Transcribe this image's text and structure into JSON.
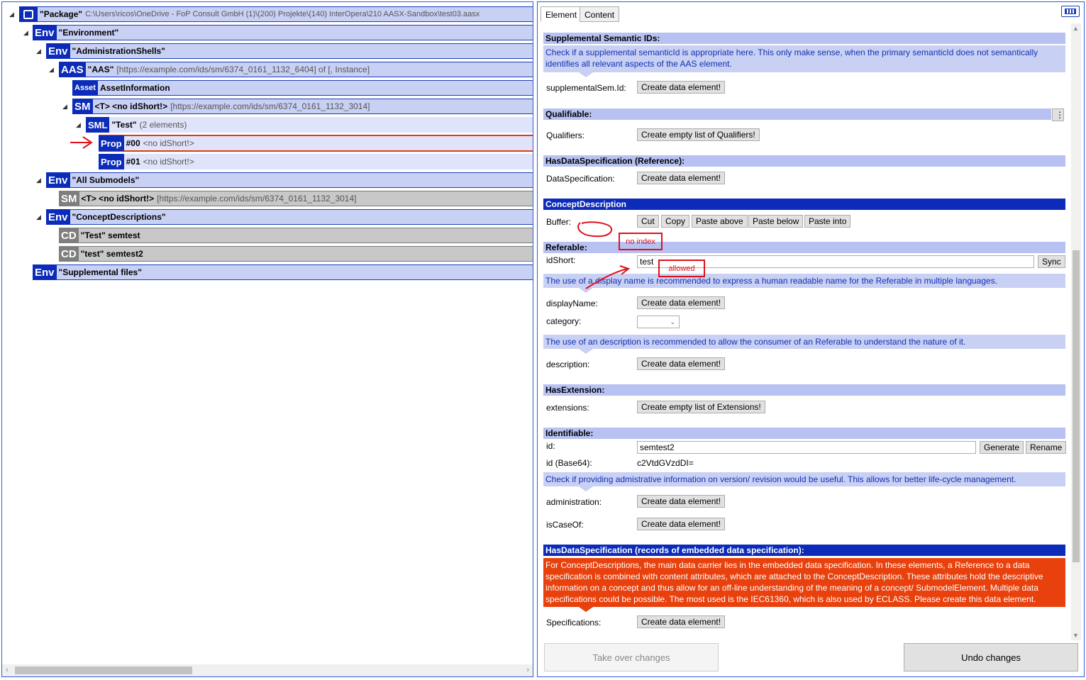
{
  "tree": {
    "package": {
      "name": "\"Package\"",
      "path": "C:\\Users\\ricos\\OneDrive - FoP Consult GmbH (1)\\(200) Projekte\\(140) InterOpera\\210 AASX-Sandbox\\test03.aasx"
    },
    "env_environment": {
      "badge": "Env",
      "name": "\"Environment\""
    },
    "env_aas": {
      "badge": "Env",
      "name": "\"AdministrationShells\""
    },
    "aas": {
      "badge": "AAS",
      "name": "\"AAS\"",
      "info": "[https://example.com/ids/sm/6374_0161_1132_6404] of [, Instance]"
    },
    "asset": {
      "badge": "Asset",
      "name": "AssetInformation"
    },
    "sm": {
      "badge": "SM",
      "name": "<T> <no idShort!>",
      "info": "[https://example.com/ids/sm/6374_0161_1132_3014]"
    },
    "sml": {
      "badge": "SML",
      "name": "\"Test\"",
      "info": "(2 elements)"
    },
    "prop0": {
      "badge": "Prop",
      "name": "#00",
      "info": "<no idShort!>"
    },
    "prop1": {
      "badge": "Prop",
      "name": "#01",
      "info": "<no idShort!>"
    },
    "env_subs": {
      "badge": "Env",
      "name": "\"All Submodels\""
    },
    "sm_all": {
      "badge": "SM",
      "name": "<T> <no idShort!>",
      "info": "[https://example.com/ids/sm/6374_0161_1132_3014]"
    },
    "env_cd": {
      "badge": "Env",
      "name": "\"ConceptDescriptions\""
    },
    "cd1": {
      "badge": "CD",
      "name": "\"Test\" semtest"
    },
    "cd2": {
      "badge": "CD",
      "name": "\"test\" semtest2"
    },
    "env_files": {
      "badge": "Env",
      "name": "\"Supplemental files\""
    }
  },
  "editor": {
    "tabs": [
      "Element",
      "Content"
    ],
    "supp": {
      "header": "Supplemental Semantic IDs:",
      "hint": "Check if a supplemental semanticId is appropriate here. This only make sense, when the primary semanticId does not semantically identifies all relevant aspects of the AAS element.",
      "label": "supplementalSem.Id:",
      "button": "Create data element!"
    },
    "qual": {
      "header": "Qualifiable:",
      "more": "⋮",
      "label": "Qualifiers:",
      "button": "Create empty list of Qualifiers!"
    },
    "hds": {
      "header": "HasDataSpecification (Reference):",
      "label": "DataSpecification:",
      "button": "Create data element!"
    },
    "cd": {
      "header": "ConceptDescription",
      "label": "Buffer:",
      "cut": "Cut",
      "copy": "Copy",
      "paste_above": "Paste above",
      "paste_below": "Paste below",
      "paste_into": "Paste into"
    },
    "ref": {
      "header": "Referable:",
      "idshort_label": "idShort:",
      "idshort_value": "test",
      "sync": "Sync",
      "hint_display": "The use of a display name is recommended to express a human readable name for the Referable in multiple languages.",
      "display_label": "displayName:",
      "display_button": "Create data element!",
      "category_label": "category:",
      "hint_desc": "The use of an description is recommended to allow the consumer of an Referable to understand the nature of it.",
      "desc_label": "description:",
      "desc_button": "Create data element!"
    },
    "ext": {
      "header": "HasExtension:",
      "label": "extensions:",
      "button": "Create empty list of Extensions!"
    },
    "ident": {
      "header": "Identifiable:",
      "id_label": "id:",
      "id_value": "semtest2",
      "generate": "Generate",
      "rename": "Rename",
      "b64_label": "id (Base64):",
      "b64_value": "c2VtdGVzdDI=",
      "hint_admin": "Check if providing admistrative information on version/ revision would be useful. This allows for better life-cycle management.",
      "admin_label": "administration:",
      "admin_button": "Create data element!",
      "caseof_label": "isCaseOf:",
      "caseof_button": "Create data element!"
    },
    "eds": {
      "header": "HasDataSpecification (records of embedded data specification):",
      "hint": "For ConceptDescriptions, the main data carrier lies in the embedded data specification. In these elements, a Reference to a data specification is combined with content attributes, which are attached to the ConceptDescription. These attributes hold the descriptive information on a concept and thus allow for an off-line understanding of the meaning of a concept/ SubmodelElement. Multiple data specifications could be possible. The most used is the IEC61360, which is also used by ECLASS. Please create this data element.",
      "label": "Specifications:",
      "button": "Create data element!"
    },
    "take_over": "Take over changes",
    "undo": "Undo changes"
  },
  "annotations": {
    "no_index": "no index",
    "allowed": "allowed"
  },
  "colors": {
    "accent": "#0b2bb8",
    "header": "#b7c1f2",
    "hint": "#c8d0f4",
    "warning": "#e8410d",
    "annotation": "#e0101a"
  }
}
